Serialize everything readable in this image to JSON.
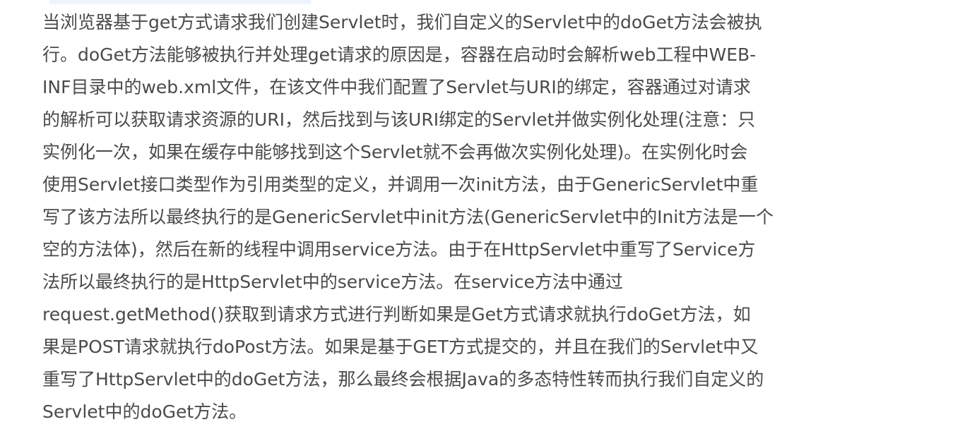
{
  "article": {
    "lines": [
      "当浏览器基于get方式请求我们创建Servlet时，我们自定义的Servlet中的doGet方法会被执",
      "行。doGet方法能够被执行并处理get请求的原因是，容器在启动时会解析web工程中WEB-",
      "INF目录中的web.xml文件，在该文件中我们配置了Servlet与URI的绑定，容器通过对请求",
      "的解析可以获取请求资源的URI，然后找到与该URI绑定的Servlet并做实例化处理(注意：只",
      "实例化一次，如果在缓存中能够找到这个Servlet就不会再做次实例化处理)。在实例化时会",
      "使用Servlet接口类型作为引用类型的定义，并调用一次init方法，由于GenericServlet中重",
      "写了该方法所以最终执行的是GenericServlet中init方法(GenericServlet中的Init方法是一个",
      "空的方法体)，然后在新的线程中调用service方法。由于在HttpServlet中重写了Service方",
      "法所以最终执行的是HttpServlet中的service方法。在service方法中通过",
      "request.getMethod()获取到请求方式进行判断如果是Get方式请求就执行doGet方法，如",
      "果是POST请求就执行doPost方法。如果是基于GET方式提交的，并且在我们的Servlet中又",
      "重写了HttpServlet中的doGet方法，那么最终会根据Java的多态特性转而执行我们自定义的",
      "Servlet中的doGet方法。"
    ]
  },
  "colors": {
    "text": "#4a4a4a",
    "background": "#ffffff",
    "highlight": "#eef4fb"
  }
}
